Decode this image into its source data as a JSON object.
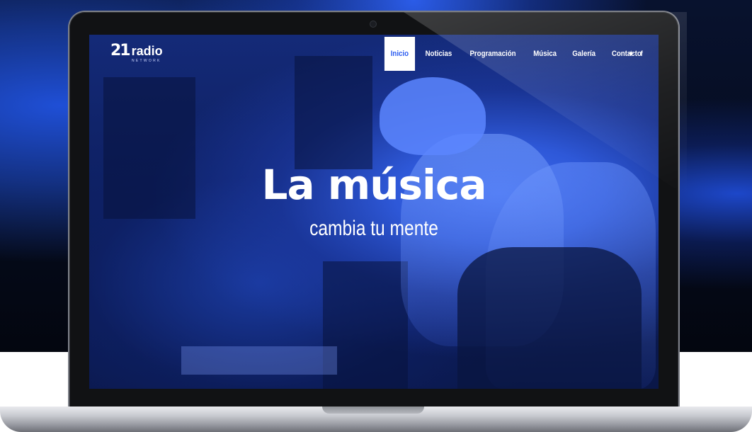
{
  "logo": {
    "mark": "21",
    "name": "radio",
    "subtitle": "NETWORK"
  },
  "nav": {
    "items": [
      {
        "label": "Inicio",
        "active": true
      },
      {
        "label": "Noticias",
        "active": false
      },
      {
        "label": "Programación",
        "active": false
      },
      {
        "label": "Música",
        "active": false
      },
      {
        "label": "Galería",
        "active": false
      },
      {
        "label": "Contacto",
        "active": false
      }
    ],
    "social": [
      {
        "icon": "twitter-icon",
        "glyph": "✦"
      },
      {
        "icon": "facebook-icon",
        "glyph": "f"
      }
    ]
  },
  "hero": {
    "title": "La música",
    "subtitle": "cambia tu mente"
  },
  "colors": {
    "accent": "#2a5bf0",
    "overlay": "#1d3fb8"
  }
}
